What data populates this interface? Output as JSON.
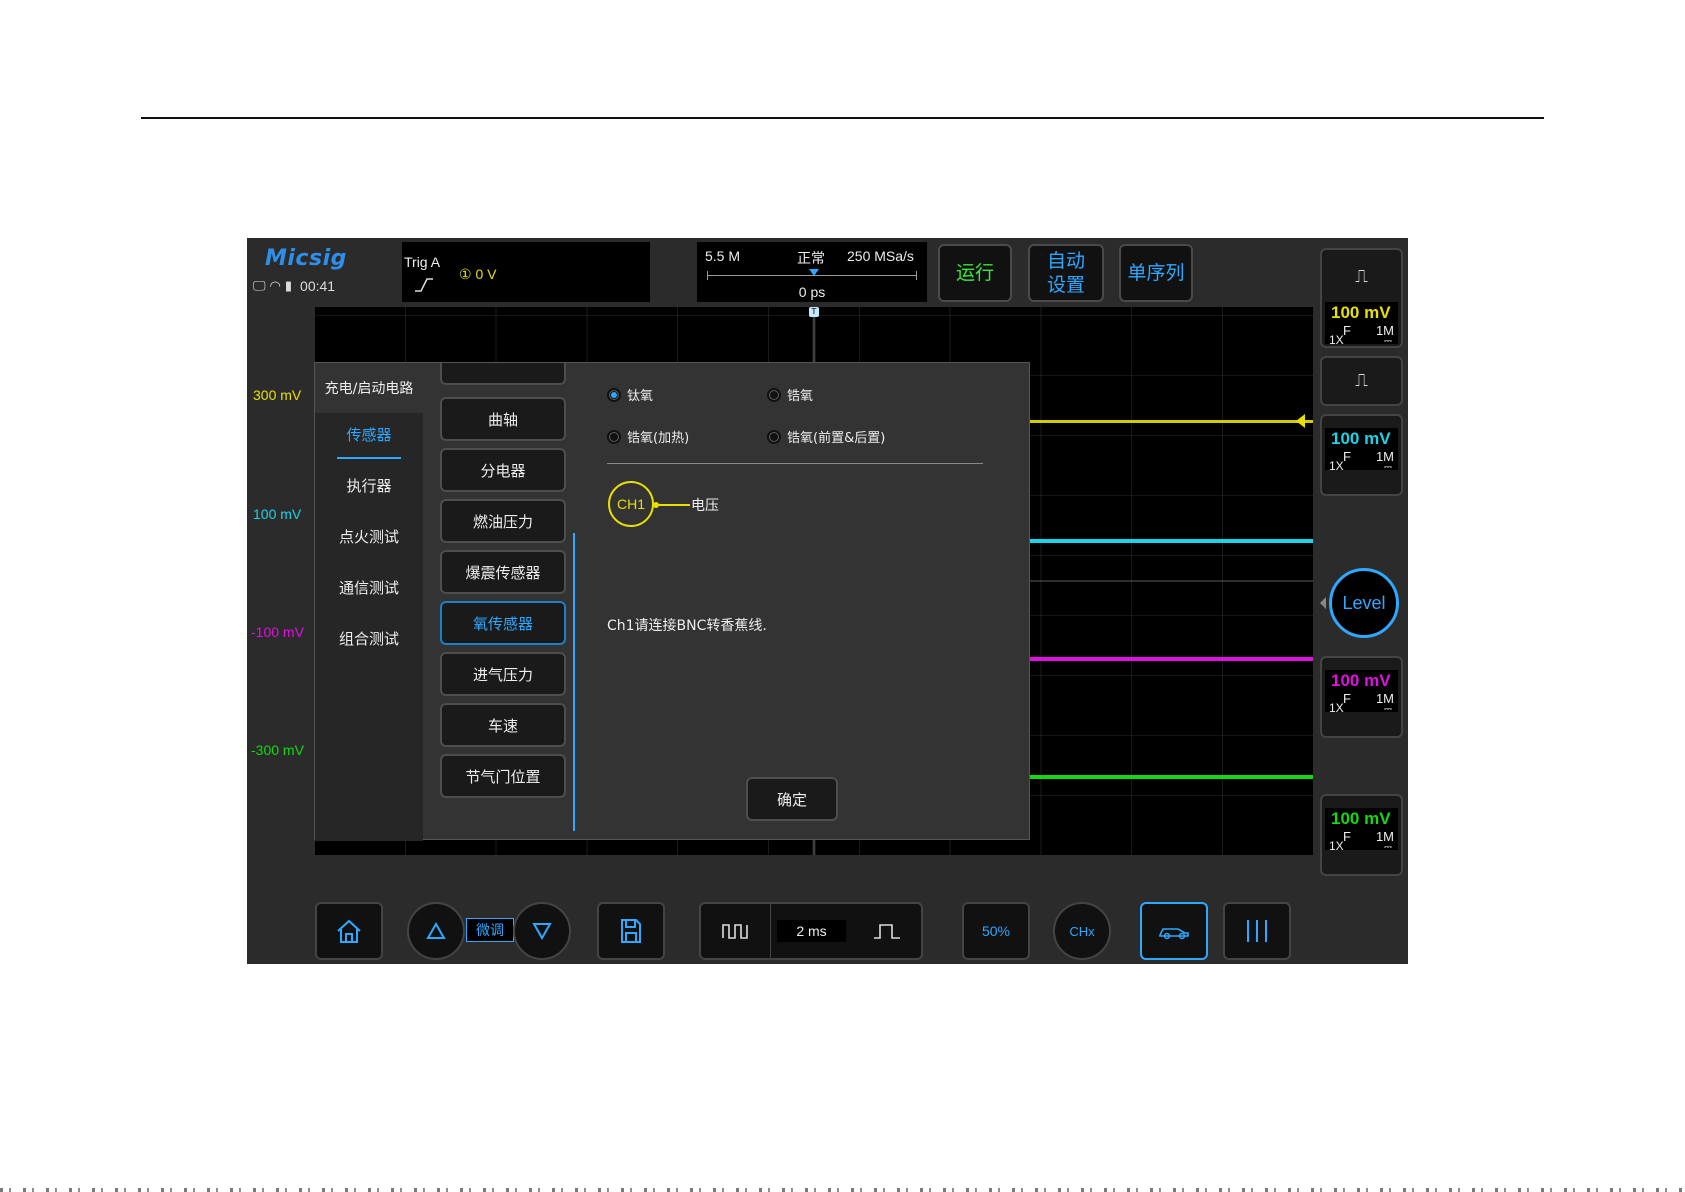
{
  "header": {
    "logo": "Micsig",
    "time": "00:41",
    "trigger": {
      "label": "Trig  A",
      "level": "① 0 V"
    },
    "timebase": {
      "memory": "5.5 M",
      "mode": "正常",
      "sample_rate": "250 MSa/s",
      "position": "0 ps"
    },
    "buttons": {
      "run": "运行",
      "auto_line1": "自动",
      "auto_line2": "设置",
      "single": "单序列"
    }
  },
  "voltage_labels": [
    {
      "text": "300 mV",
      "color": "#e8e000"
    },
    {
      "text": "100 mV",
      "color": "#1cd4e8"
    },
    {
      "text": "-100 mV",
      "color": "#e010e0"
    },
    {
      "text": "-300 mV",
      "color": "#14d814"
    }
  ],
  "channels": [
    {
      "scale": "100 mV",
      "coupling": "F",
      "impedance": "1M",
      "probe": "1X",
      "color": "#e8e000"
    },
    {
      "scale": "100 mV",
      "coupling": "F",
      "impedance": "1M",
      "probe": "1X",
      "color": "#1cd4e8"
    },
    {
      "scale": "100 mV",
      "coupling": "F",
      "impedance": "1M",
      "probe": "1X",
      "color": "#e010e0"
    },
    {
      "scale": "100 mV",
      "coupling": "F",
      "impedance": "1M",
      "probe": "1X",
      "color": "#14d814"
    }
  ],
  "level_button": "Level",
  "dialog": {
    "categories": [
      "充电/启动电路",
      "传感器",
      "执行器",
      "点火测试",
      "通信测试",
      "组合测试"
    ],
    "selected_category": "传感器",
    "sensors": [
      "曲轴",
      "分电器",
      "燃油压力",
      "爆震传感器",
      "氧传感器",
      "进气压力",
      "车速",
      "节气门位置"
    ],
    "selected_sensor": "氧传感器",
    "options": [
      {
        "label": "钛氧",
        "checked": true
      },
      {
        "label": "锆氧",
        "checked": false
      },
      {
        "label": "锆氧(加热)",
        "checked": false
      },
      {
        "label": "锆氧(前置&后置)",
        "checked": false
      }
    ],
    "channel_label": "CH1",
    "channel_signal": "电压",
    "hint": "Ch1请连接BNC转香蕉线.",
    "confirm": "确定"
  },
  "toolbar": {
    "fine": "微调",
    "timebase": "2 ms",
    "fifty": "50%",
    "chx": "CHx"
  }
}
